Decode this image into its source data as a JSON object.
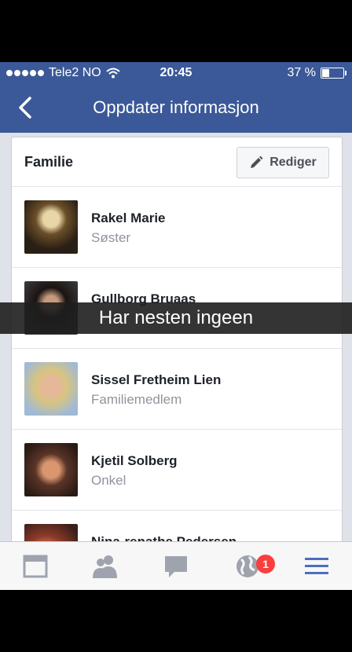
{
  "status_bar": {
    "carrier": "Tele2 NO",
    "time": "20:45",
    "battery": "37 %",
    "battery_level": 0.37
  },
  "nav": {
    "title": "Oppdater informasjon",
    "back_icon": "chevron-left-icon"
  },
  "section": {
    "title": "Familie",
    "edit_label": "Rediger",
    "edit_icon": "pencil-icon"
  },
  "members": [
    {
      "name": "Rakel Marie",
      "relation": "Søster"
    },
    {
      "name": "Gullborg Bruaas",
      "relation": ""
    },
    {
      "name": "Sissel Fretheim Lien",
      "relation": "Familiemedlem"
    },
    {
      "name": "Kjetil Solberg",
      "relation": "Onkel"
    },
    {
      "name": "Nina-renathe Pedersen",
      "relation": ""
    }
  ],
  "overlay_caption": "Har nesten ingeen",
  "tab_bar": {
    "tabs": [
      "news-feed-icon",
      "friend-requests-icon",
      "messages-icon",
      "notifications-globe-icon",
      "menu-icon"
    ],
    "notification_badge": "1",
    "colors": {
      "active": "#4b6ebf",
      "inactive": "#9ea3ad"
    }
  },
  "colors": {
    "brand": "#3b5998",
    "badge": "#fa3e3e"
  }
}
